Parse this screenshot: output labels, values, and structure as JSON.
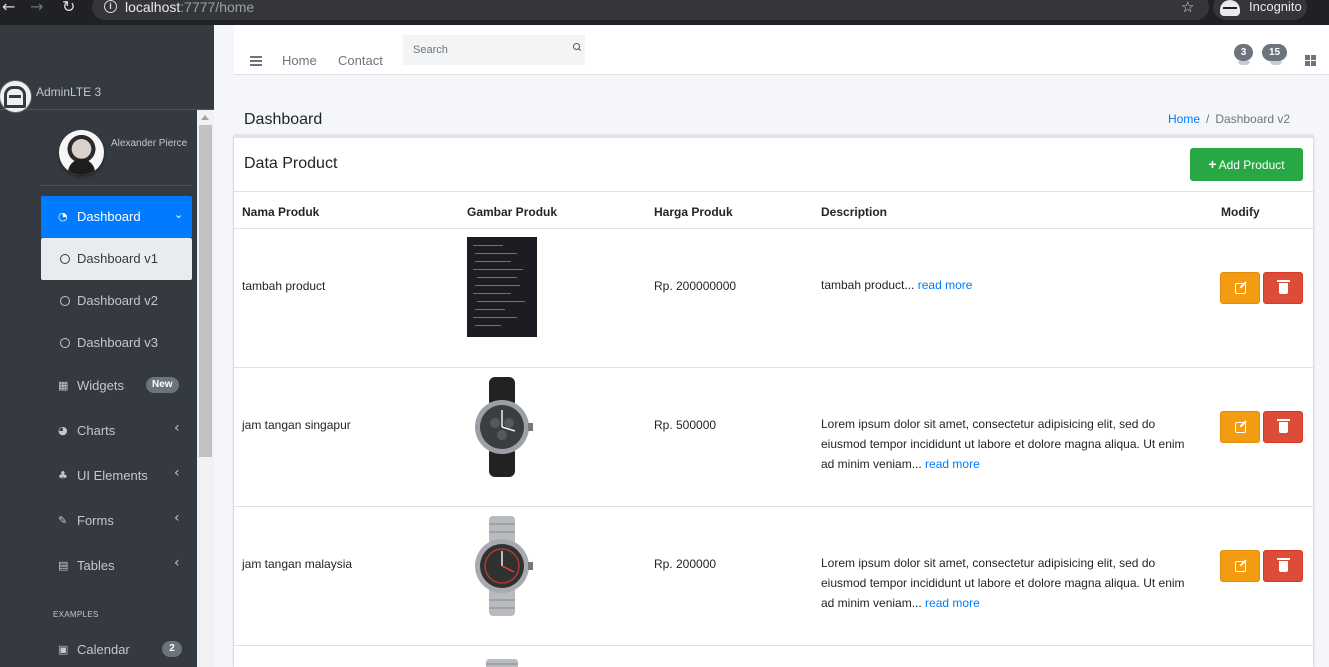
{
  "browser": {
    "url_host": "localhost",
    "url_path": ":7777/home",
    "incognito_label": "Incognito"
  },
  "sidebar": {
    "brand": "AdminLTE 3",
    "user_name": "Alexander Pierce",
    "items": [
      {
        "label": "Dashboard",
        "icon": "tachometer-icon"
      },
      {
        "label": "Dashboard v1",
        "icon": "circle-icon"
      },
      {
        "label": "Dashboard v2",
        "icon": "circle-icon"
      },
      {
        "label": "Dashboard v3",
        "icon": "circle-icon"
      },
      {
        "label": "Widgets",
        "icon": "th-icon",
        "badge": "New"
      },
      {
        "label": "Charts",
        "icon": "pie-chart-icon"
      },
      {
        "label": "UI Elements",
        "icon": "tree-icon"
      },
      {
        "label": "Forms",
        "icon": "edit-icon"
      },
      {
        "label": "Tables",
        "icon": "table-icon"
      }
    ],
    "section_header": "EXAMPLES",
    "calendar": {
      "label": "Calendar",
      "badge": "2",
      "icon": "calendar-icon"
    }
  },
  "navbar": {
    "home": "Home",
    "contact": "Contact",
    "search_placeholder": "Search",
    "messages_count": "3",
    "notifications_count": "15"
  },
  "content_header": {
    "title": "Dashboard",
    "breadcrumb_home": "Home",
    "breadcrumb_sep": "/",
    "breadcrumb_current": "Dashboard v2"
  },
  "card": {
    "title": "Data Product",
    "add_button": "Add Product",
    "columns": [
      "Nama Produk",
      "Gambar Produk",
      "Harga Produk",
      "Description",
      "Modify"
    ],
    "rows": [
      {
        "name": "tambah product",
        "price": "Rp. 200000000",
        "desc": "tambah product...",
        "read_more": "read more"
      },
      {
        "name": "jam tangan singapur",
        "price": "Rp. 500000",
        "desc": "Lorem ipsum dolor sit amet, consectetur adipisicing elit, sed do eiusmod tempor incididunt ut labore et dolore magna aliqua. Ut enim ad minim veniam...",
        "read_more": "read more"
      },
      {
        "name": "jam tangan malaysia",
        "price": "Rp. 200000",
        "desc": "Lorem ipsum dolor sit amet, consectetur adipisicing elit, sed do eiusmod tempor incididunt ut labore et dolore magna aliqua. Ut enim ad minim veniam...",
        "read_more": "read more"
      }
    ]
  },
  "colors": {
    "sidebar": "#343a40",
    "active": "#007bff",
    "add_button": "#28a745",
    "edit_button": "#f39c12",
    "delete_button": "#dd4b39"
  }
}
